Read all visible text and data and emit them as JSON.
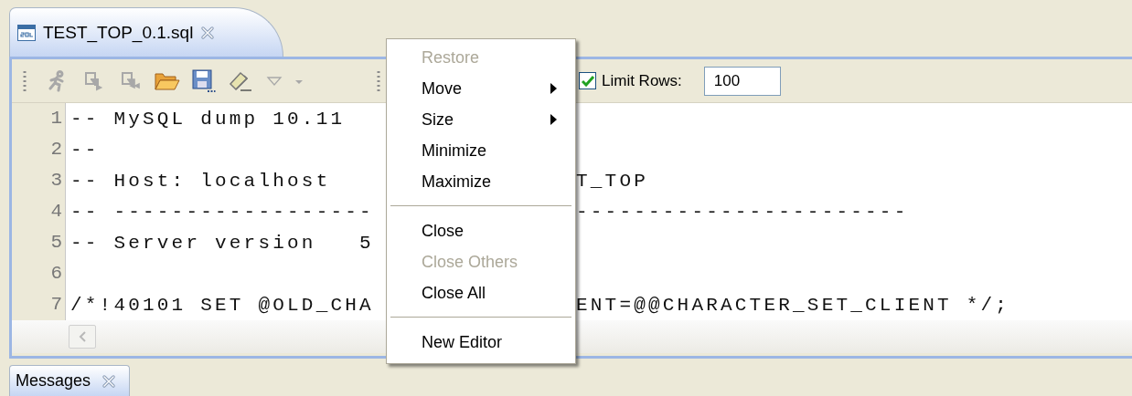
{
  "editor_tab": {
    "title": "TEST_TOP_0.1.sql",
    "selected": true
  },
  "toolbar": {
    "buttons": [
      {
        "kind": "run",
        "disabled": true
      },
      {
        "kind": "step",
        "disabled": true
      },
      {
        "kind": "step-back",
        "disabled": true
      },
      {
        "kind": "open",
        "disabled": false
      },
      {
        "kind": "save",
        "disabled": false
      },
      {
        "kind": "clear",
        "disabled": false
      },
      {
        "kind": "dropdown",
        "disabled": true
      }
    ],
    "limit_rows": {
      "label": "Limit Rows:",
      "checked": true,
      "value": "100"
    }
  },
  "code_lines": [
    {
      "number": "1",
      "text": "-- MySQL dump 10.11"
    },
    {
      "number": "2",
      "text": "--"
    },
    {
      "number": "3",
      "text": "-- Host: localhost",
      "text_right": "T_TOP"
    },
    {
      "number": "4",
      "text": "-- ------------------",
      "text_right": "-----------------------"
    },
    {
      "number": "5",
      "text": "-- Server version   5"
    },
    {
      "number": "6"
    },
    {
      "number": "7",
      "text": "/*!40101 SET @OLD_CHA",
      "text_right": "ENT=@@CHARACTER_SET_CLIENT */;"
    }
  ],
  "context_menu": {
    "items": [
      {
        "kind": "item",
        "label": "Restore",
        "disabled": true,
        "submenu": false
      },
      {
        "kind": "item",
        "label": "Move",
        "disabled": false,
        "submenu": true
      },
      {
        "kind": "item",
        "label": "Size",
        "disabled": false,
        "submenu": true
      },
      {
        "kind": "item",
        "label": "Minimize",
        "disabled": false,
        "submenu": false
      },
      {
        "kind": "item",
        "label": "Maximize",
        "disabled": false,
        "submenu": false
      },
      {
        "kind": "separator"
      },
      {
        "kind": "item",
        "label": "Close",
        "disabled": false,
        "submenu": false
      },
      {
        "kind": "item",
        "label": "Close Others",
        "disabled": true,
        "submenu": false
      },
      {
        "kind": "item",
        "label": "Close All",
        "disabled": false,
        "submenu": false
      },
      {
        "kind": "separator"
      },
      {
        "kind": "item",
        "label": "New Editor",
        "disabled": false,
        "submenu": false
      }
    ]
  },
  "bottom_tabs": [
    {
      "label": "Messages",
      "selected": true
    }
  ]
}
